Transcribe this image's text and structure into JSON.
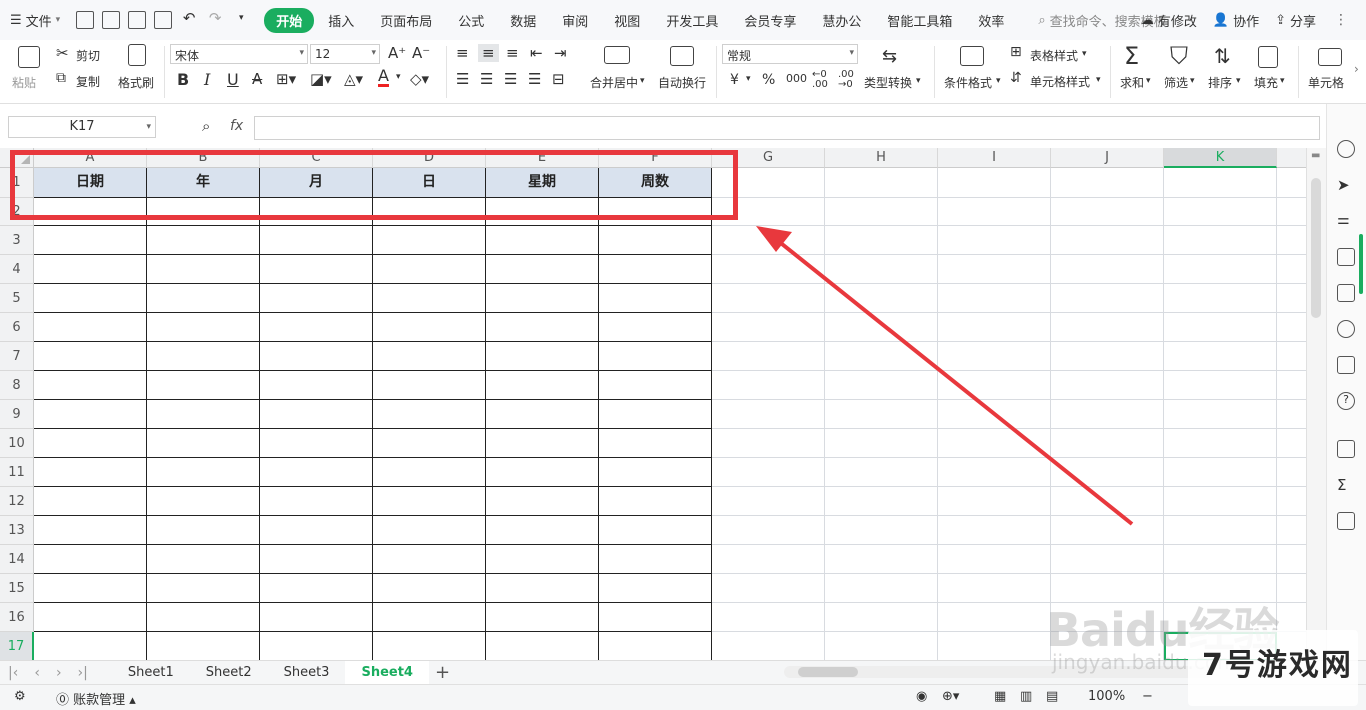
{
  "menubar": {
    "file_label": "文件",
    "tabs": [
      "开始",
      "插入",
      "页面布局",
      "公式",
      "数据",
      "审阅",
      "视图",
      "开发工具",
      "会员专享",
      "慧办公",
      "智能工具箱",
      "效率"
    ],
    "search_placeholder": "查找命令、搜索模板",
    "has_changes": "有修改",
    "collaborate": "协作",
    "share": "分享"
  },
  "ribbon": {
    "paste": "粘贴",
    "cut": "剪切",
    "copy": "复制",
    "format_painter": "格式刷",
    "font_name": "宋体",
    "font_size": "12",
    "bold": "B",
    "italic": "I",
    "underline": "U",
    "merge_center": "合并居中",
    "wrap_text": "自动换行",
    "number_format": "常规",
    "type_convert": "类型转换",
    "conditional_format": "条件格式",
    "table_style": "表格样式",
    "cell_style": "单元格样式",
    "sum": "求和",
    "filter": "筛选",
    "sort": "排序",
    "fill": "填充",
    "cell": "单元格",
    "currency": "¥",
    "percent": "%"
  },
  "formula_bar": {
    "cell_ref": "K17",
    "fx": "fx",
    "value": ""
  },
  "sheet": {
    "columns": [
      "A",
      "B",
      "C",
      "D",
      "E",
      "F",
      "G",
      "H",
      "I",
      "J",
      "K"
    ],
    "selected_column": "K",
    "rows": [
      "1",
      "2",
      "3",
      "4",
      "5",
      "6",
      "7",
      "8",
      "9",
      "10",
      "11",
      "12",
      "13",
      "14",
      "15",
      "16",
      "17"
    ],
    "selected_row": "17",
    "header_cells": [
      "日期",
      "年",
      "月",
      "日",
      "星期",
      "周数"
    ]
  },
  "sheet_tabs": [
    "Sheet1",
    "Sheet2",
    "Sheet3",
    "Sheet4"
  ],
  "active_sheet": "Sheet4",
  "status": {
    "account_mgmt": "账款管理",
    "zoom": "100%"
  },
  "watermark": {
    "baidu": "Baidu经验",
    "url": "jingyan.baidu.com",
    "logo": "7号游戏网"
  },
  "colors": {
    "accent": "#1aad5f",
    "highlight_box": "#e8383d",
    "header_fill": "#d9e2ee"
  }
}
